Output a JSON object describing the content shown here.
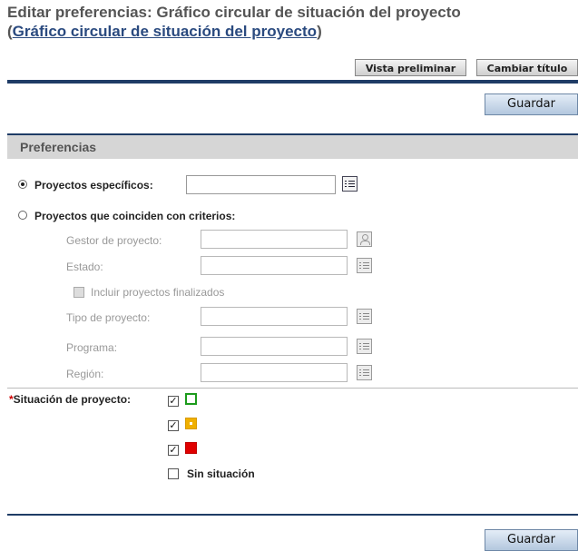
{
  "header": {
    "title_prefix": "Editar preferencias: Gráfico circular de situación del proyecto",
    "paren_open": "(",
    "title_link": "Gráfico circular de situación del proyecto",
    "paren_close": ")"
  },
  "toolbar": {
    "preview_label": "Vista preliminar",
    "rename_label": "Cambiar título"
  },
  "save_label": "Guardar",
  "section_title": "Preferencias",
  "form": {
    "specific_projects_label": "Proyectos específicos:",
    "criteria_label": "Proyectos que coinciden con criterios:",
    "manager_label": "Gestor de proyecto:",
    "state_label": "Estado:",
    "include_finished_label": "Incluir proyectos finalizados",
    "project_type_label": "Tipo de proyecto:",
    "program_label": "Programa:",
    "region_label": "Región:",
    "required_mark": "*",
    "status_label": "Situación de proyecto:",
    "no_status_label": "Sin situación",
    "check_mark": "✓"
  },
  "colors": {
    "green": "#1c9b1c",
    "yellow": "#f0b000",
    "red": "#e00000",
    "navy": "#1f3c66"
  },
  "icons": [
    "list-selector-icon",
    "user-picker-icon",
    "status-square-icon"
  ]
}
